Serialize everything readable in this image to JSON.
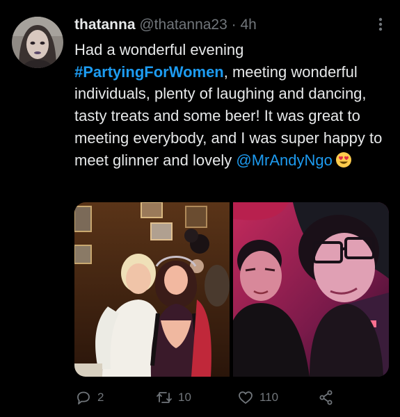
{
  "author": {
    "display_name": "thatanna",
    "handle": "@thatanna23",
    "separator": "·",
    "time": "4h"
  },
  "tweet": {
    "line_start": "Had a wonderful evening",
    "hashtag": "#PartyingForWomen",
    "text_middle": ", meeting wonderful individuals, plenty of laughing and dancing, tasty treats and some beer! It was great to meeting everybody, and I was super happy to meet glinner and lovely ",
    "mention": "@MrAndyNgo",
    "emoji": "heart-eyes-emoji"
  },
  "actions": {
    "reply_count": "2",
    "retweet_count": "10",
    "like_count": "110"
  },
  "icons": {
    "more": "more-dots-icon",
    "reply": "reply-icon",
    "retweet": "retweet-icon",
    "like": "heart-icon",
    "share": "share-icon"
  },
  "colors": {
    "background": "#000000",
    "text": "#e7e9ea",
    "muted": "#71767b",
    "accent": "#1d9bf0"
  }
}
